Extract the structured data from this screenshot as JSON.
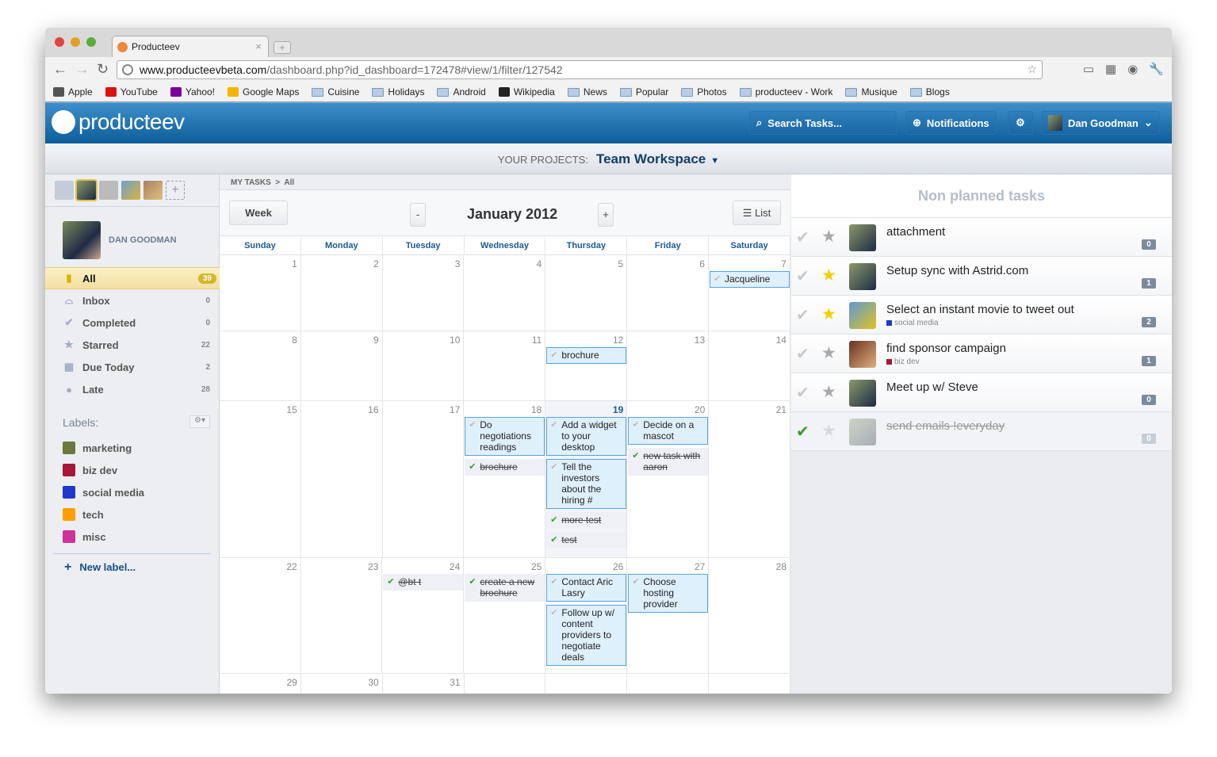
{
  "browser": {
    "tab_title": "Producteev",
    "url_host": "www.producteevbeta.com",
    "url_path": "/dashboard.php?id_dashboard=172478#view/1/filter/127542",
    "bookmarks": [
      "Apple",
      "YouTube",
      "Yahoo!",
      "Google Maps",
      "Cuisine",
      "Holidays",
      "Android",
      "Wikipedia",
      "News",
      "Popular",
      "Photos",
      "producteev - Work",
      "Musique",
      "Blogs"
    ]
  },
  "header": {
    "logo": "producteev",
    "search": "Search Tasks...",
    "notifications": "Notifications",
    "user": "Dan Goodman"
  },
  "projects": {
    "label": "YOUR PROJECTS:",
    "current": "Team Workspace"
  },
  "sidebar": {
    "user_name": "DAN GOODMAN",
    "items": [
      {
        "label": "All",
        "count": "39",
        "icon": "all-tasks-icon"
      },
      {
        "label": "Inbox",
        "count": "0",
        "icon": "inbox-icon"
      },
      {
        "label": "Completed",
        "count": "0",
        "icon": "check-icon"
      },
      {
        "label": "Starred",
        "count": "22",
        "icon": "star-icon"
      },
      {
        "label": "Due Today",
        "count": "2",
        "icon": "calendar-icon"
      },
      {
        "label": "Late",
        "count": "28",
        "icon": "alert-icon"
      }
    ],
    "labels_title": "Labels:",
    "labels": [
      {
        "name": "marketing",
        "color": "#6b7a3c"
      },
      {
        "name": "biz dev",
        "color": "#a8163a"
      },
      {
        "name": "social media",
        "color": "#2038c8"
      },
      {
        "name": "tech",
        "color": "#ff9f00"
      },
      {
        "name": "misc",
        "color": "#cc3399"
      }
    ],
    "new_label": "New label..."
  },
  "calendar": {
    "breadcrumb": [
      "MY TASKS",
      "All"
    ],
    "week_button": "Week",
    "prev": "-",
    "next": "+",
    "month": "January 2012",
    "list_button": "List",
    "weekdays": [
      "Sunday",
      "Monday",
      "Tuesday",
      "Wednesday",
      "Thursday",
      "Friday",
      "Saturday"
    ],
    "today": 19,
    "weeks": [
      [
        {
          "d": 1
        },
        {
          "d": 2
        },
        {
          "d": 3
        },
        {
          "d": 4
        },
        {
          "d": 5
        },
        {
          "d": 6
        },
        {
          "d": 7,
          "ev": [
            {
              "t": "Jacqueline",
              "done": false
            }
          ]
        }
      ],
      [
        {
          "d": 8
        },
        {
          "d": 9
        },
        {
          "d": 10
        },
        {
          "d": 11
        },
        {
          "d": 12,
          "ev": [
            {
              "t": "brochure",
              "done": false
            }
          ]
        },
        {
          "d": 13
        },
        {
          "d": 14
        }
      ],
      [
        {
          "d": 15
        },
        {
          "d": 16
        },
        {
          "d": 17
        },
        {
          "d": 18,
          "ev": [
            {
              "t": "Do negotiations readings",
              "done": false
            },
            {
              "t": "brochure",
              "done": true
            }
          ]
        },
        {
          "d": 19,
          "ev": [
            {
              "t": "Add a widget to your desktop",
              "done": false
            },
            {
              "t": "Tell the investors about the hiring #",
              "done": false
            },
            {
              "t": "more test",
              "done": true
            },
            {
              "t": "test",
              "done": true
            }
          ]
        },
        {
          "d": 20,
          "ev": [
            {
              "t": "Decide on a mascot",
              "done": false
            },
            {
              "t": "new task with aaron",
              "done": true
            }
          ]
        },
        {
          "d": 21
        }
      ],
      [
        {
          "d": 22
        },
        {
          "d": 23
        },
        {
          "d": 24,
          "ev": [
            {
              "t": "@bt t",
              "done": true
            }
          ]
        },
        {
          "d": 25,
          "ev": [
            {
              "t": "create a new brochure",
              "done": true
            }
          ]
        },
        {
          "d": 26,
          "ev": [
            {
              "t": "Contact Aric Lasry",
              "done": false
            },
            {
              "t": "Follow up w/ content providers to negotiate deals",
              "done": false
            }
          ]
        },
        {
          "d": 27,
          "ev": [
            {
              "t": "Choose hosting provider",
              "done": false
            }
          ]
        },
        {
          "d": 28
        }
      ],
      [
        {
          "d": 29
        },
        {
          "d": 30
        },
        {
          "d": 31
        },
        {
          "d": null
        },
        {
          "d": null
        },
        {
          "d": null
        },
        {
          "d": null
        }
      ]
    ]
  },
  "non_planned": {
    "title": "Non planned tasks",
    "tasks": [
      {
        "name": "attachment",
        "star": "",
        "comments": "0",
        "done": false,
        "label": null
      },
      {
        "name": "Setup sync with Astrid.com",
        "star": "1",
        "comments": "1",
        "done": false,
        "label": null
      },
      {
        "name": "Select an instant movie to tweet out",
        "star": "2",
        "comments": "2",
        "done": false,
        "label": {
          "name": "social media",
          "color": "#2038c8"
        }
      },
      {
        "name": "find sponsor campaign",
        "star": "",
        "comments": "1",
        "done": false,
        "label": {
          "name": "biz dev",
          "color": "#a8163a"
        }
      },
      {
        "name": "Meet up w/ Steve",
        "star": "",
        "comments": "0",
        "done": false,
        "label": null
      },
      {
        "name": "send emails !everyday",
        "star": "",
        "comments": "0",
        "done": true,
        "label": null
      }
    ]
  }
}
